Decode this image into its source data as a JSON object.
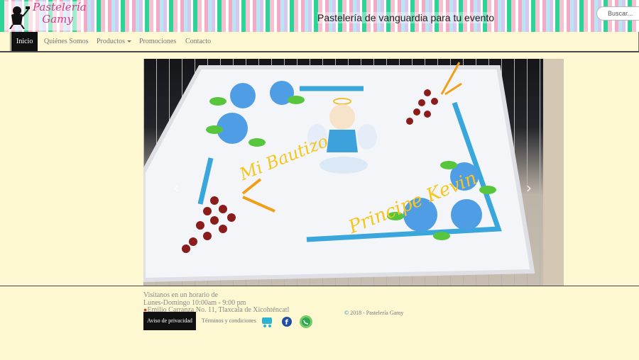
{
  "header": {
    "logo_line1": "Pastelería",
    "logo_line2": "Gamy",
    "tagline": "Pastelería de vanguardia para tu evento",
    "search_placeholder": "Buscar..."
  },
  "nav": {
    "items": [
      {
        "label": "Inicio",
        "active": true
      },
      {
        "label": "Quiénes Somos",
        "active": false
      },
      {
        "label": "Productos",
        "active": false,
        "dropdown": true
      },
      {
        "label": "Promociones",
        "active": false
      },
      {
        "label": "Contacto",
        "active": false
      }
    ]
  },
  "carousel": {
    "cake_text_1": "Mi Bautizo",
    "cake_text_2": "Principe Kevin",
    "prev_icon": "chevron-left-icon",
    "next_icon": "chevron-right-icon"
  },
  "footer": {
    "hours_line1": "Visitanos en un horario de",
    "hours_line2": "Lunes-Domingo 10:00am - 9:00 pm",
    "address": "Emilio Carranza No. 11, Tlaxcala de Xicohténcatl",
    "privacy_label": "Aviso de privacidad",
    "terms_label": "Términos y condiciones",
    "copyright": "2018 - Pastelería Gamy",
    "social_icons": [
      "cart-icon",
      "facebook-icon",
      "whatsapp-icon"
    ]
  },
  "colors": {
    "background": "#fdf8d2",
    "logo_pink": "#ce3f86",
    "nav_active": "#111111"
  }
}
